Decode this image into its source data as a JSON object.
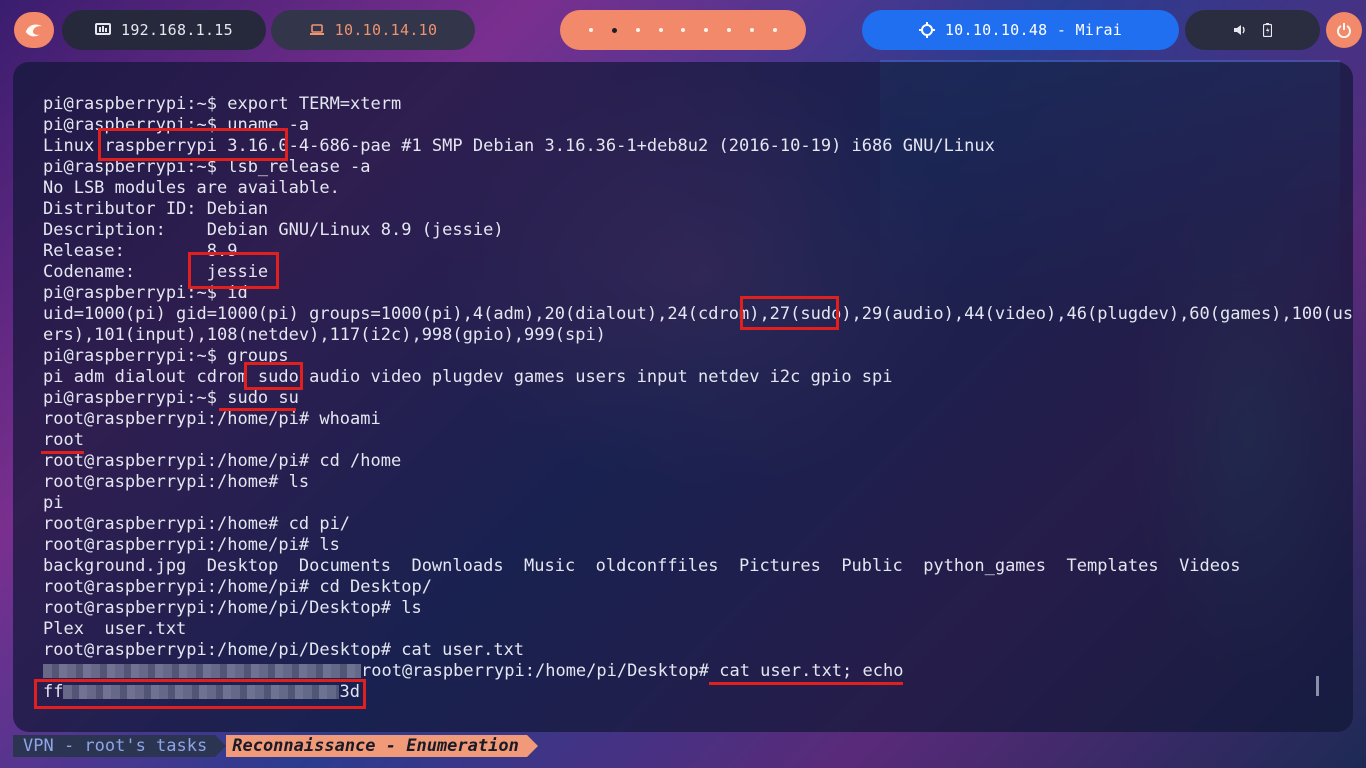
{
  "topbar": {
    "host_ip": "192.168.1.15",
    "vpn_ip": "10.10.14.10",
    "workspaces": 9,
    "active_workspace_index": 1,
    "target": "10.10.10.48 - Mirai",
    "icons": [
      "kali-dragon-icon",
      "monitor-icon",
      "laptop-icon",
      "crosshair-icon",
      "volume-icon",
      "battery-icon",
      "power-icon"
    ]
  },
  "terminal": {
    "lines": [
      "pi@raspberrypi:~$ export TERM=xterm",
      "pi@raspberrypi:~$ uname -a",
      "Linux raspberrypi 3.16.0-4-686-pae #1 SMP Debian 3.16.36-1+deb8u2 (2016-10-19) i686 GNU/Linux",
      "pi@raspberrypi:~$ lsb_release -a",
      "No LSB modules are available.",
      "Distributor ID: Debian",
      "Description:    Debian GNU/Linux 8.9 (jessie)",
      "Release:        8.9",
      "Codename:       jessie",
      "pi@raspberrypi:~$ id",
      "uid=1000(pi) gid=1000(pi) groups=1000(pi),4(adm),20(dialout),24(cdrom),27(sudo),29(audio),44(video),46(plugdev),60(games),100(us",
      "ers),101(input),108(netdev),117(i2c),998(gpio),999(spi)",
      "pi@raspberrypi:~$ groups",
      "pi adm dialout cdrom sudo audio video plugdev games users input netdev i2c gpio spi",
      "pi@raspberrypi:~$ sudo su",
      "root@raspberrypi:/home/pi# whoami",
      "root",
      "root@raspberrypi:/home/pi# cd /home",
      "root@raspberrypi:/home# ls",
      "pi",
      "root@raspberrypi:/home# cd pi/",
      "root@raspberrypi:/home/pi# ls",
      "background.jpg  Desktop  Documents  Downloads  Music  oldconffiles  Pictures  Public  python_games  Templates  Videos",
      "root@raspberrypi:/home/pi# cd Desktop/",
      "root@raspberrypi:/home/pi/Desktop# ls",
      "Plex  user.txt",
      "root@raspberrypi:/home/pi/Desktop# cat user.txt"
    ],
    "line_27_suffix": "root@raspberrypi:/home/pi/Desktop# cat user.txt; echo",
    "flag_prefix": "ff",
    "flag_suffix": "3d"
  },
  "statusbar": {
    "session": "VPN - root's tasks",
    "window": "Reconnaissance - Enumeration"
  },
  "colors": {
    "accent": "#f2896b",
    "target_pill": "#1f6ff0",
    "highlight": "#e01f1f",
    "terminal_text": "#e4e6f0"
  }
}
